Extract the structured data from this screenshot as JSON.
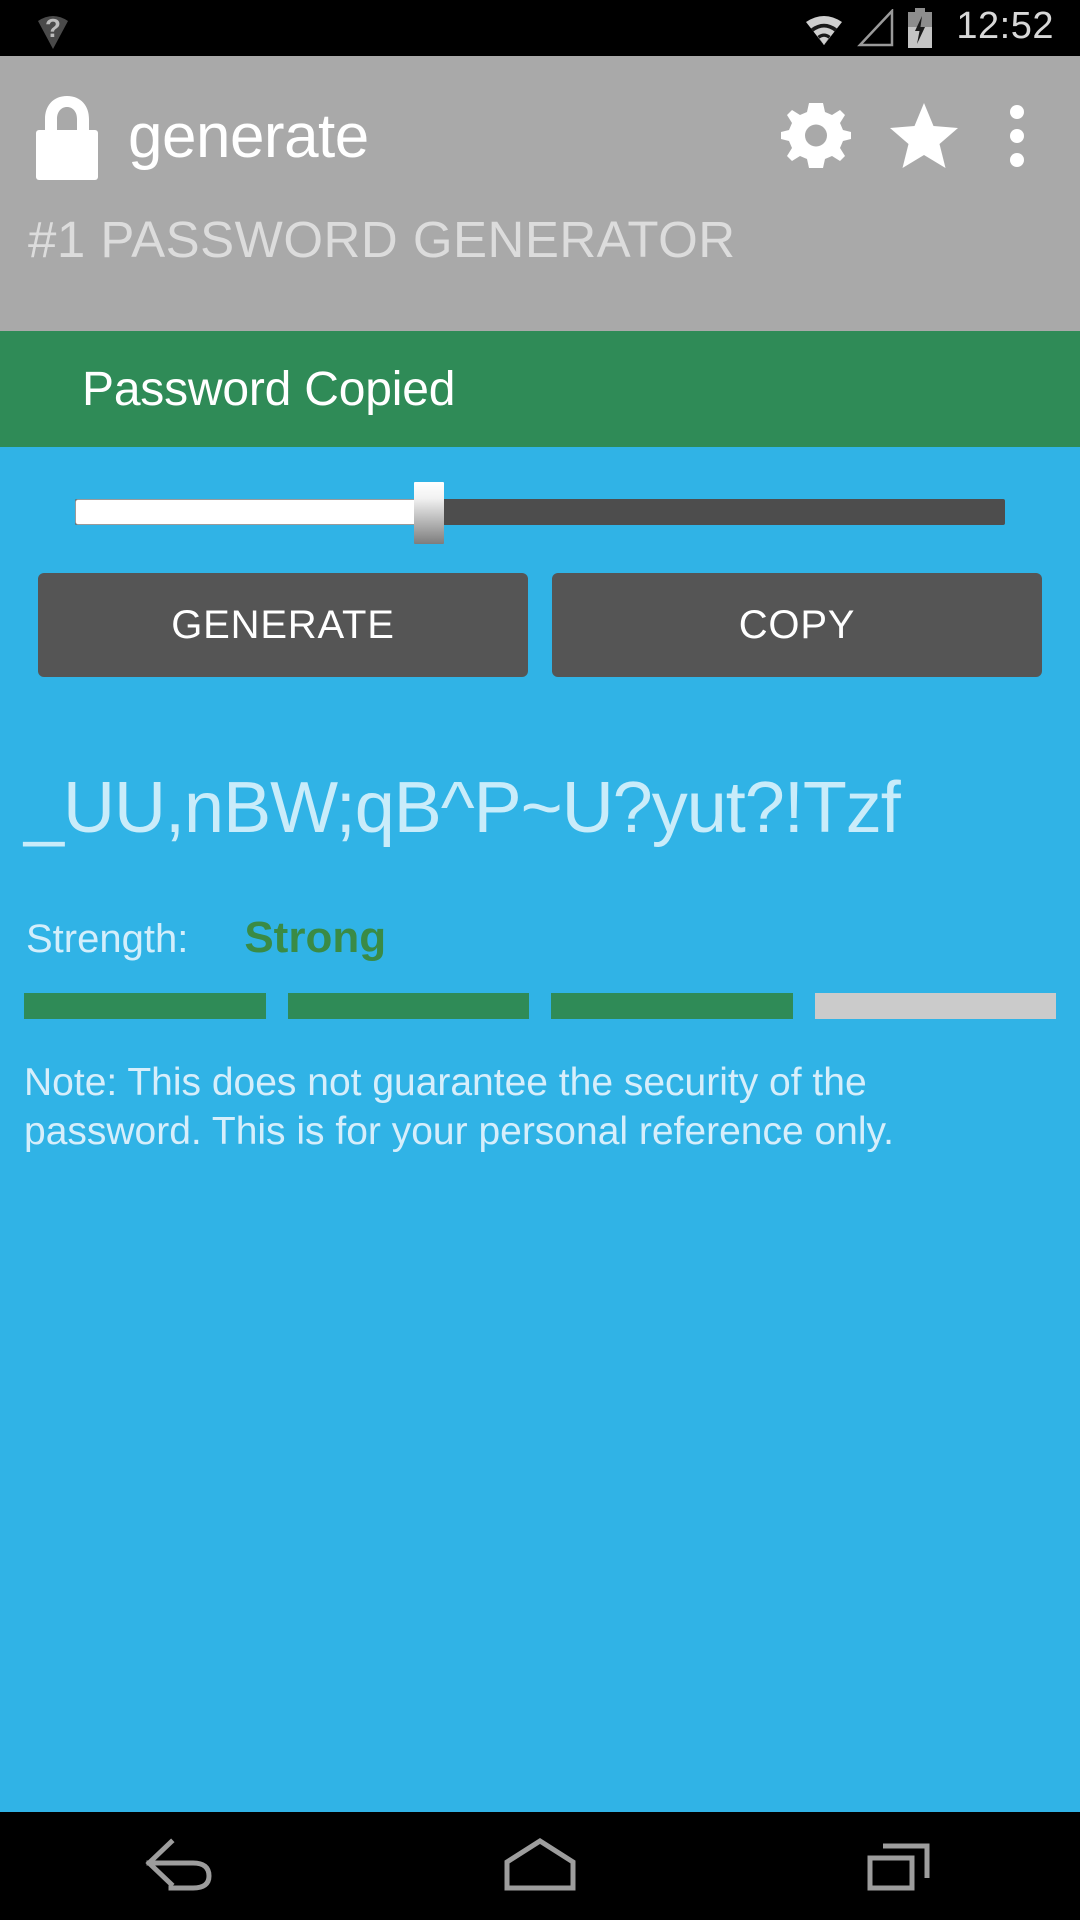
{
  "statusbar": {
    "time": "12:52",
    "icons": [
      "wifi-question-icon",
      "wifi-icon",
      "cell-signal-icon",
      "battery-charging-icon"
    ]
  },
  "actionbar": {
    "lock_icon": "lock-icon",
    "title": "generate",
    "subtitle": "#1 PASSWORD GENERATOR",
    "actions": [
      {
        "name": "settings-button",
        "icon": "gear-icon"
      },
      {
        "name": "favorite-button",
        "icon": "star-icon"
      },
      {
        "name": "overflow-menu-button",
        "icon": "more-vertical-icon"
      }
    ],
    "background_color": "#a9a9a9",
    "title_color": "#ffffff",
    "subtitle_color": "#dcdcdc"
  },
  "banner": {
    "message": "Password Copied",
    "background_color": "#2f8b57",
    "text_color": "#ffffff"
  },
  "length_slider": {
    "name": "password-length-slider",
    "value_percent": 38
  },
  "buttons": {
    "generate_label": "GENERATE",
    "copy_label": "COPY",
    "background_color": "#555555",
    "text_color": "#ffffff"
  },
  "password": {
    "value": "_UU,nBW;qB^P~U?yut?!Tzf",
    "text_color": "#c9ecfa"
  },
  "strength": {
    "label": "Strength:",
    "value": "Strong",
    "value_color": "#3a8b45",
    "bars_filled": 3,
    "bars_total": 4,
    "bar_on_color": "#2f8b57",
    "bar_off_color": "#cbcbcb"
  },
  "note": {
    "text": "Note: This does not guarantee the security of the password. This is for your personal reference only."
  },
  "navbar": {
    "buttons": [
      {
        "name": "back-button",
        "icon": "back-arrow-icon"
      },
      {
        "name": "home-button",
        "icon": "home-icon"
      },
      {
        "name": "recents-button",
        "icon": "recents-icon"
      }
    ]
  },
  "theme": {
    "page_background": "#30b3e6"
  }
}
